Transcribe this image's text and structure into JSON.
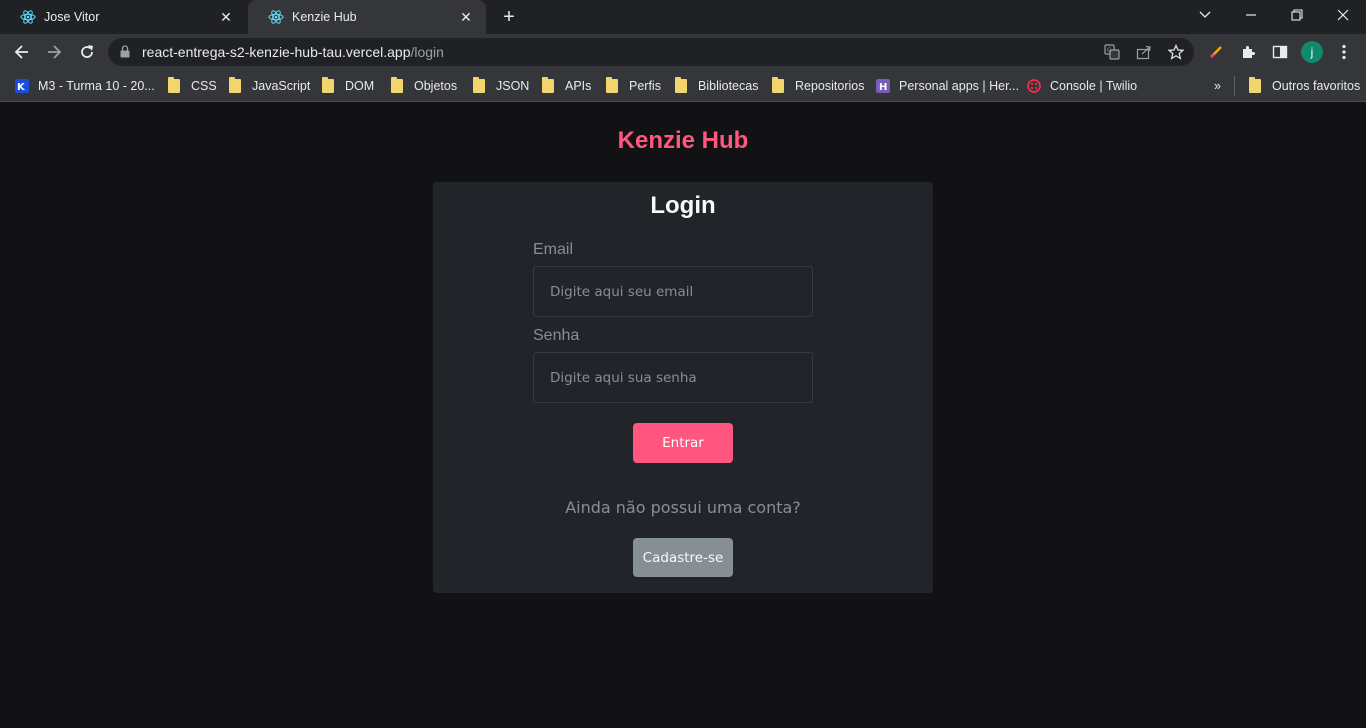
{
  "browser": {
    "tabs": [
      {
        "title": "Jose Vitor",
        "icon": "react-icon"
      },
      {
        "title": "Kenzie Hub",
        "icon": "react-icon"
      }
    ],
    "url_host": "react-entrega-s2-kenzie-hub-tau.vercel.app",
    "url_path": "/login",
    "profile_initial": "j",
    "bookmarks": [
      {
        "label": "M3 - Turma 10 - 20...",
        "icon": "kenzie-icon"
      },
      {
        "label": "CSS",
        "icon": "folder-icon"
      },
      {
        "label": "JavaScript",
        "icon": "folder-icon"
      },
      {
        "label": "DOM",
        "icon": "folder-icon"
      },
      {
        "label": "Objetos",
        "icon": "folder-icon"
      },
      {
        "label": "JSON",
        "icon": "folder-icon"
      },
      {
        "label": "APIs",
        "icon": "folder-icon"
      },
      {
        "label": "Perfis",
        "icon": "folder-icon"
      },
      {
        "label": "Bibliotecas",
        "icon": "folder-icon"
      },
      {
        "label": "Repositorios",
        "icon": "folder-icon"
      },
      {
        "label": "Personal apps | Her...",
        "icon": "heroku-icon"
      },
      {
        "label": "Console | Twilio",
        "icon": "twilio-icon"
      }
    ],
    "overflow_label": "»",
    "other_bookmarks": "Outros favoritos"
  },
  "page": {
    "brand": "Kenzie Hub",
    "form": {
      "title": "Login",
      "email_label": "Email",
      "email_placeholder": "Digite aqui seu email",
      "password_label": "Senha",
      "password_placeholder": "Digite aqui sua senha",
      "submit_label": "Entrar",
      "signup_prompt": "Ainda não possui uma conta?",
      "signup_label": "Cadastre-se"
    }
  },
  "colors": {
    "brand": "#ff577f",
    "background": "#121214",
    "card": "#212529",
    "muted": "#868e96"
  }
}
